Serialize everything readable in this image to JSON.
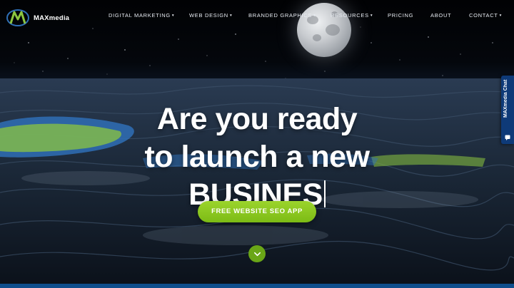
{
  "brand": {
    "name": "MAXmedia",
    "accent": "#8cc63f",
    "navy": "#0e3a78"
  },
  "nav": {
    "items": [
      {
        "label": "DIGITAL MARKETING",
        "has_dropdown": true
      },
      {
        "label": "WEB DESIGN",
        "has_dropdown": true
      },
      {
        "label": "BRANDED GRAPHICS",
        "has_dropdown": true
      },
      {
        "label": "RESOURCES",
        "has_dropdown": true
      },
      {
        "label": "PRICING",
        "has_dropdown": false
      },
      {
        "label": "ABOUT",
        "has_dropdown": false
      },
      {
        "label": "CONTACT",
        "has_dropdown": true
      }
    ],
    "caret": "▾"
  },
  "hero": {
    "line1": "Are you ready",
    "line2": "to launch a new",
    "line3": "BUSINES"
  },
  "cta": {
    "label": "FREE WEBSITE SEO APP"
  },
  "scroll": {
    "icon": "chevron-down-icon"
  },
  "chat": {
    "label": "MAXmedia Chat",
    "icon": "chat-bubble-icon"
  }
}
